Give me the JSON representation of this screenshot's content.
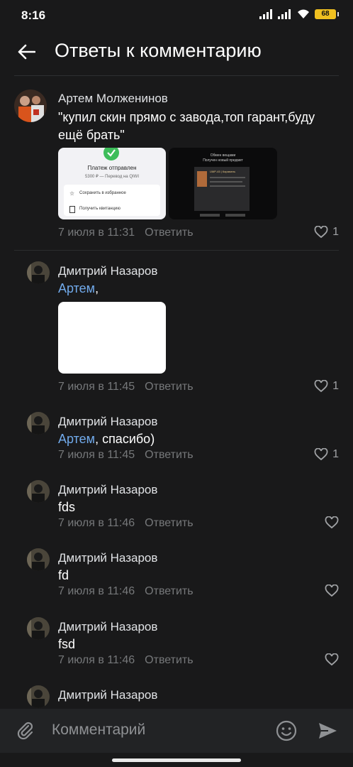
{
  "status": {
    "time": "8:16",
    "battery": "68"
  },
  "header": {
    "title": "Ответы к комментарию"
  },
  "root_comment": {
    "author": "Артем Молженинов",
    "text": "\"купил скин прямо с завода,топ гарант,буду ещё брать\"",
    "date": "7 июля в 11:31",
    "reply_label": "Ответить",
    "likes": "1",
    "receipt": {
      "title": "Платеж отправлен",
      "subtitle": "5300 ₽ — Перевод на QIWI",
      "action1": "Сохранить в избранное",
      "action2": "Получить квитанцию"
    },
    "trade": {
      "line1": "Обмен вещами",
      "line2": "Получен новый предмет",
      "item": "UMP-45 | Карамель"
    }
  },
  "replies": [
    {
      "author": "Дмитрий Назаров",
      "mention": "Артем",
      "rest": ",",
      "date": "7 июля в 11:45",
      "reply_label": "Ответить",
      "likes": "1"
    },
    {
      "author": "Дмитрий Назаров",
      "mention": "Артем",
      "rest": ", спасибо)",
      "date": "7 июля в 11:45",
      "reply_label": "Ответить",
      "likes": "1"
    },
    {
      "author": "Дмитрий Назаров",
      "mention": "",
      "rest": "fds",
      "date": "7 июля в 11:46",
      "reply_label": "Ответить",
      "likes": ""
    },
    {
      "author": "Дмитрий Назаров",
      "mention": "",
      "rest": "fd",
      "date": "7 июля в 11:46",
      "reply_label": "Ответить",
      "likes": ""
    },
    {
      "author": "Дмитрий Назаров",
      "mention": "",
      "rest": "fsd",
      "date": "7 июля в 11:46",
      "reply_label": "Ответить",
      "likes": ""
    },
    {
      "author": "Дмитрий Назаров"
    }
  ],
  "composer": {
    "placeholder": "Комментарий"
  },
  "icons": {
    "back": "arrow-left-icon",
    "attach": "paperclip-icon",
    "emoji": "smile-icon",
    "send": "send-icon",
    "like": "heart-icon"
  },
  "colors": {
    "accent": "#71aaeb",
    "background": "#19191a"
  }
}
